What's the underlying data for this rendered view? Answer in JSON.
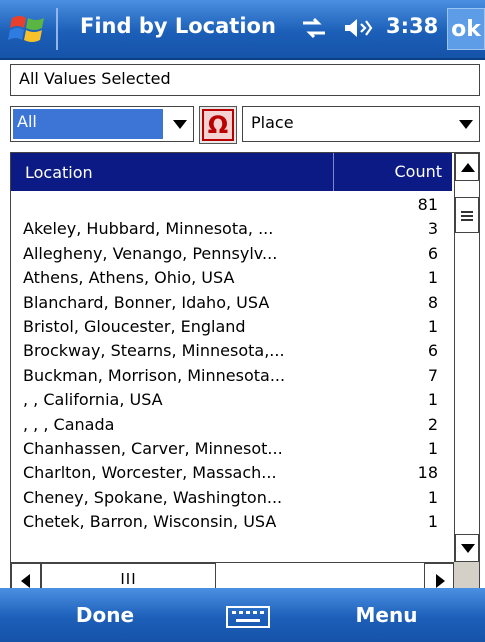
{
  "titlebar": {
    "title": "Find by Location",
    "time": "3:38",
    "ok_label": "ok"
  },
  "status": {
    "text": "All Values Selected"
  },
  "filters": {
    "scope_value": "All",
    "field_value": "Place",
    "omega_symbol": "Ω"
  },
  "list": {
    "columns": {
      "location": "Location",
      "count": "Count"
    },
    "rows": [
      {
        "location": "",
        "count": "81"
      },
      {
        "location": "Akeley, Hubbard, Minnesota, ...",
        "count": "3"
      },
      {
        "location": "Allegheny, Venango, Pennsylv...",
        "count": "6"
      },
      {
        "location": "Athens, Athens, Ohio, USA",
        "count": "1"
      },
      {
        "location": "Blanchard, Bonner, Idaho, USA",
        "count": "8"
      },
      {
        "location": "Bristol, Gloucester, England",
        "count": "1"
      },
      {
        "location": "Brockway, Stearns, Minnesota,...",
        "count": "6"
      },
      {
        "location": "Buckman, Morrison, Minnesota...",
        "count": "7"
      },
      {
        "location": ", , California, USA",
        "count": "1"
      },
      {
        "location": ", , , Canada",
        "count": "2"
      },
      {
        "location": "Chanhassen, Carver, Minnesot...",
        "count": "1"
      },
      {
        "location": "Charlton, Worcester, Massach...",
        "count": "18"
      },
      {
        "location": "Cheney, Spokane, Washington...",
        "count": "1"
      },
      {
        "location": "Chetek, Barron, Wisconsin, USA",
        "count": "1"
      }
    ],
    "hscroll_grip": "III"
  },
  "softkeys": {
    "left": "Done",
    "right": "Menu"
  },
  "colors": {
    "titlebar": "#1c5fb8",
    "header": "#0c1a86",
    "selection": "#3d75d6",
    "omega": "#b00000"
  },
  "icons": [
    "windows-start-icon",
    "sync-icon",
    "volume-icon",
    "keyboard-icon"
  ]
}
